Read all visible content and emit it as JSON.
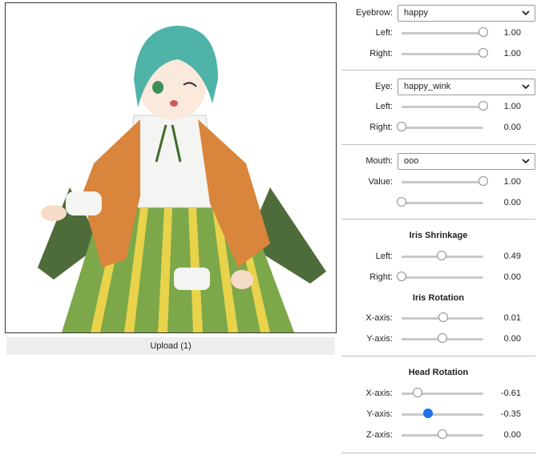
{
  "image": {
    "description_icon": "character-illustration",
    "colors": {
      "hair": "#4fb3a8",
      "jacket": "#d9853b",
      "skirt": "#7da84a",
      "stripe": "#e8d34a",
      "shirt": "#f4f4f2"
    }
  },
  "upload": {
    "label": "Upload (1)"
  },
  "eyebrow": {
    "label": "Eyebrow:",
    "selected": "happy",
    "left": {
      "label": "Left:",
      "value": "1.00",
      "fraction": 1.0
    },
    "right": {
      "label": "Right:",
      "value": "1.00",
      "fraction": 1.0
    }
  },
  "eye": {
    "label": "Eye:",
    "selected": "happy_wink",
    "left": {
      "label": "Left:",
      "value": "1.00",
      "fraction": 1.0
    },
    "right": {
      "label": "Right:",
      "value": "0.00",
      "fraction": 0.0
    }
  },
  "mouth": {
    "label": "Mouth:",
    "selected": "ooo",
    "value1": {
      "label": "Value:",
      "value": "1.00",
      "fraction": 1.0
    },
    "value2": {
      "label": "",
      "value": "0.00",
      "fraction": 0.0
    }
  },
  "iris_shrinkage": {
    "title": "Iris Shrinkage",
    "left": {
      "label": "Left:",
      "value": "0.49",
      "fraction": 0.49
    },
    "right": {
      "label": "Right:",
      "value": "0.00",
      "fraction": 0.0
    }
  },
  "iris_rotation": {
    "title": "Iris Rotation",
    "x": {
      "label": "X-axis:",
      "value": "0.01",
      "fraction": 0.505
    },
    "y": {
      "label": "Y-axis:",
      "value": "0.00",
      "fraction": 0.5
    }
  },
  "head_rotation": {
    "title": "Head Rotation",
    "x": {
      "label": "X-axis:",
      "value": "-0.61",
      "fraction": 0.195
    },
    "y": {
      "label": "Y-axis:",
      "value": "-0.35",
      "fraction": 0.325,
      "active": true
    },
    "z": {
      "label": "Z-axis:",
      "value": "0.00",
      "fraction": 0.5
    }
  },
  "colors": {
    "accent": "#1a73e8",
    "track": "#c9c9c9",
    "divider": "#bdbdbd"
  }
}
